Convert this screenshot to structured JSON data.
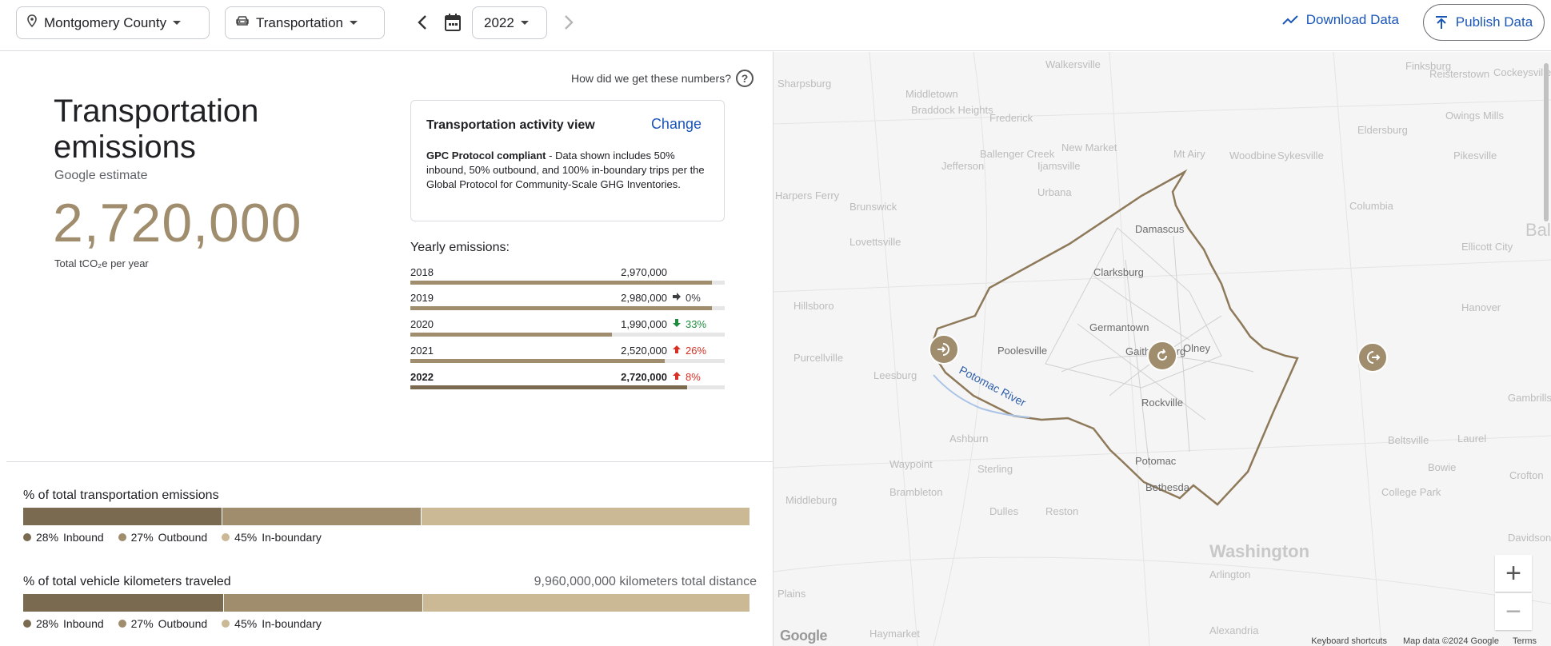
{
  "header": {
    "location": "Montgomery County",
    "category": "Transportation",
    "year": "2022",
    "download_label": "Download Data",
    "publish_label": "Publish Data"
  },
  "summary": {
    "title": "Transportation emissions",
    "subtitle": "Google estimate",
    "total": "2,720,000",
    "unit": "Total tCO₂e per year",
    "how_label": "How did we get these numbers?"
  },
  "card": {
    "title": "Transportation activity view",
    "change_label": "Change",
    "body_bold": "GPC Protocol compliant",
    "body_rest": " - Data shown includes 50% inbound, 50% outbound, and 100% in-boundary trips per the Global Protocol for Community-Scale GHG Inventories."
  },
  "yearly": {
    "label": "Yearly emissions:",
    "rows": [
      {
        "year": "2018",
        "value": "2,970,000",
        "change": "",
        "dir": "none",
        "fraction": 0.96
      },
      {
        "year": "2019",
        "value": "2,980,000",
        "change": "0%",
        "dir": "flat",
        "fraction": 0.96
      },
      {
        "year": "2020",
        "value": "1,990,000",
        "change": "33%",
        "dir": "down",
        "fraction": 0.64
      },
      {
        "year": "2021",
        "value": "2,520,000",
        "change": "26%",
        "dir": "up",
        "fraction": 0.81
      },
      {
        "year": "2022",
        "value": "2,720,000",
        "change": "8%",
        "dir": "up",
        "fraction": 0.88
      }
    ]
  },
  "share_emissions": {
    "title": "% of total transportation emissions",
    "parts": [
      {
        "label": "Inbound",
        "pct": "28%",
        "value": 27.4,
        "color": "#7a6a50"
      },
      {
        "label": "Outbound",
        "pct": "27%",
        "value": 27.4,
        "color": "#a08d6d"
      },
      {
        "label": "In-boundary",
        "pct": "45%",
        "value": 45.2,
        "color": "#cbb996"
      }
    ]
  },
  "share_km": {
    "title": "% of total vehicle kilometers traveled",
    "total_label": "9,960,000,000 kilometers total distance",
    "parts": [
      {
        "label": "Inbound",
        "pct": "28%",
        "value": 27.6,
        "color": "#7a6a50"
      },
      {
        "label": "Outbound",
        "pct": "27%",
        "value": 27.5,
        "color": "#a08d6d"
      },
      {
        "label": "In-boundary",
        "pct": "45%",
        "value": 44.9,
        "color": "#cbb996"
      }
    ]
  },
  "map": {
    "labels": [
      "Walkersville",
      "Finksburg",
      "Reisterstown",
      "Cockeysville",
      "Sharpsburg",
      "Middletown",
      "Braddock Heights",
      "Frederick",
      "Eldersburg",
      "Owings Mills",
      "New Market",
      "Mt Airy",
      "Woodbine",
      "Sykesville",
      "Pikesville",
      "Ballenger Creek",
      "Jefferson",
      "Ijamsville",
      "Brunswick",
      "Harpers Ferry",
      "Urbana",
      "Damascus",
      "Ellicott City",
      "Lovettsville",
      "Clarksburg",
      "Hillsboro",
      "Germantown",
      "Hanover",
      "Purcellville",
      "Poolesville",
      "Gaithersburg",
      "Olney",
      "Leesburg",
      "Rockville",
      "Ashburn",
      "Potomac",
      "Waypoint",
      "Sterling",
      "Bethesda",
      "Brambleton",
      "Dulles",
      "Reston",
      "Middleburg",
      "College Park",
      "Washington",
      "Arlington",
      "Plains",
      "Alexandria",
      "Haymarket",
      "Bal",
      "Columbia",
      "Gambrills",
      "Bowie",
      "Crofton",
      "Laurel",
      "Beltsville",
      "Davidsonville"
    ],
    "river": "Potomac River",
    "zoom_in": "+",
    "zoom_out": "−",
    "google": "Google",
    "footer": [
      "Keyboard shortcuts",
      "Map data ©2024 Google",
      "Terms"
    ]
  }
}
